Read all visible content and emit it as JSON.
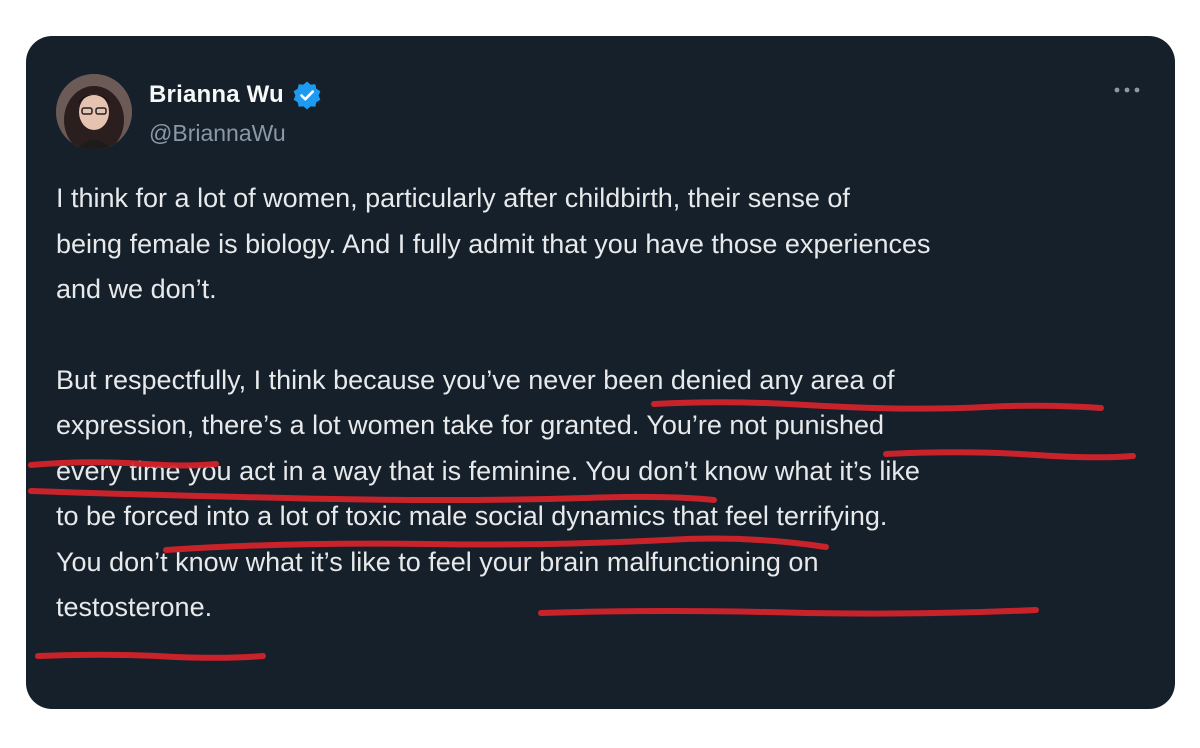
{
  "author": {
    "display_name": "Brianna Wu",
    "handle": "@BriannaWu"
  },
  "icons": {
    "verified": "verified-badge-icon",
    "more": "more-options-icon"
  },
  "tweet": {
    "paragraphs": [
      "I think for a lot of women, particularly after childbirth, their sense of\nbeing female is biology. And I fully admit that you have those experiences\nand we don’t.",
      "But respectfully, I think because you’ve never been denied any area of\nexpression, there’s a lot women take for granted. You’re not punished\nevery time you act in a way that is feminine. You don’t know what it’s like\nto be forced into a lot of toxic male social dynamics that feel terrifying.\nYou don’t know what it’s like to feel your brain malfunctioning on\ntestosterone."
    ]
  },
  "colors": {
    "card_background": "#15202b",
    "primary_text": "#e7e9ea",
    "secondary_text": "#8b98a5",
    "verified_blue": "#1d9bf0",
    "annotation_red": "#d8232a"
  }
}
